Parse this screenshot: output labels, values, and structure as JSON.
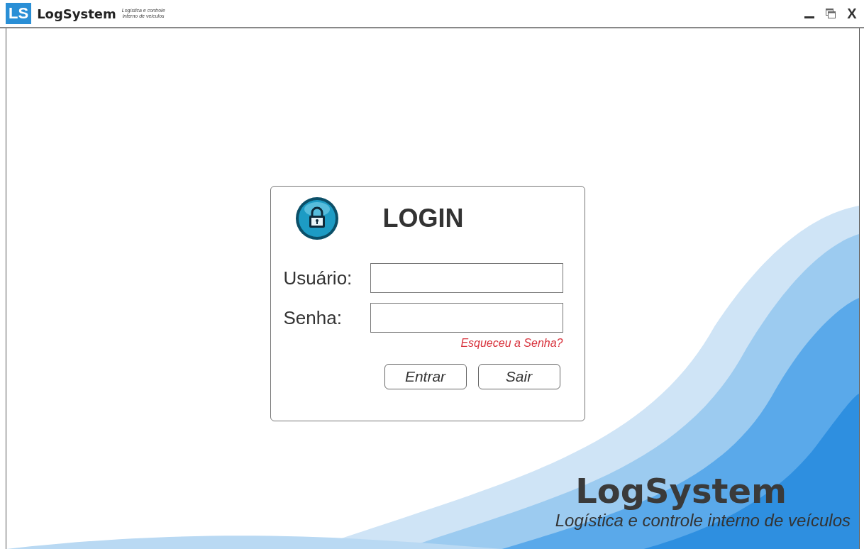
{
  "titlebar": {
    "logo_mark": "LS",
    "app_name": "LogSystem",
    "tagline_lines": [
      "Logística e controle",
      "interno de veículos"
    ],
    "controls": [
      {
        "kind": "minimize"
      },
      {
        "kind": "restore"
      },
      {
        "kind": "close",
        "label": "X"
      }
    ]
  },
  "login": {
    "title": "LOGIN",
    "fields": [
      {
        "label": "Usuário:"
      },
      {
        "label": "Senha:"
      }
    ],
    "forgot_link": "Esqueceu a Senha?",
    "buttons": [
      "Entrar",
      "Sair"
    ]
  },
  "branding": {
    "name": "LogSystem",
    "subtitle": "Logística e controle interno de veículos"
  }
}
